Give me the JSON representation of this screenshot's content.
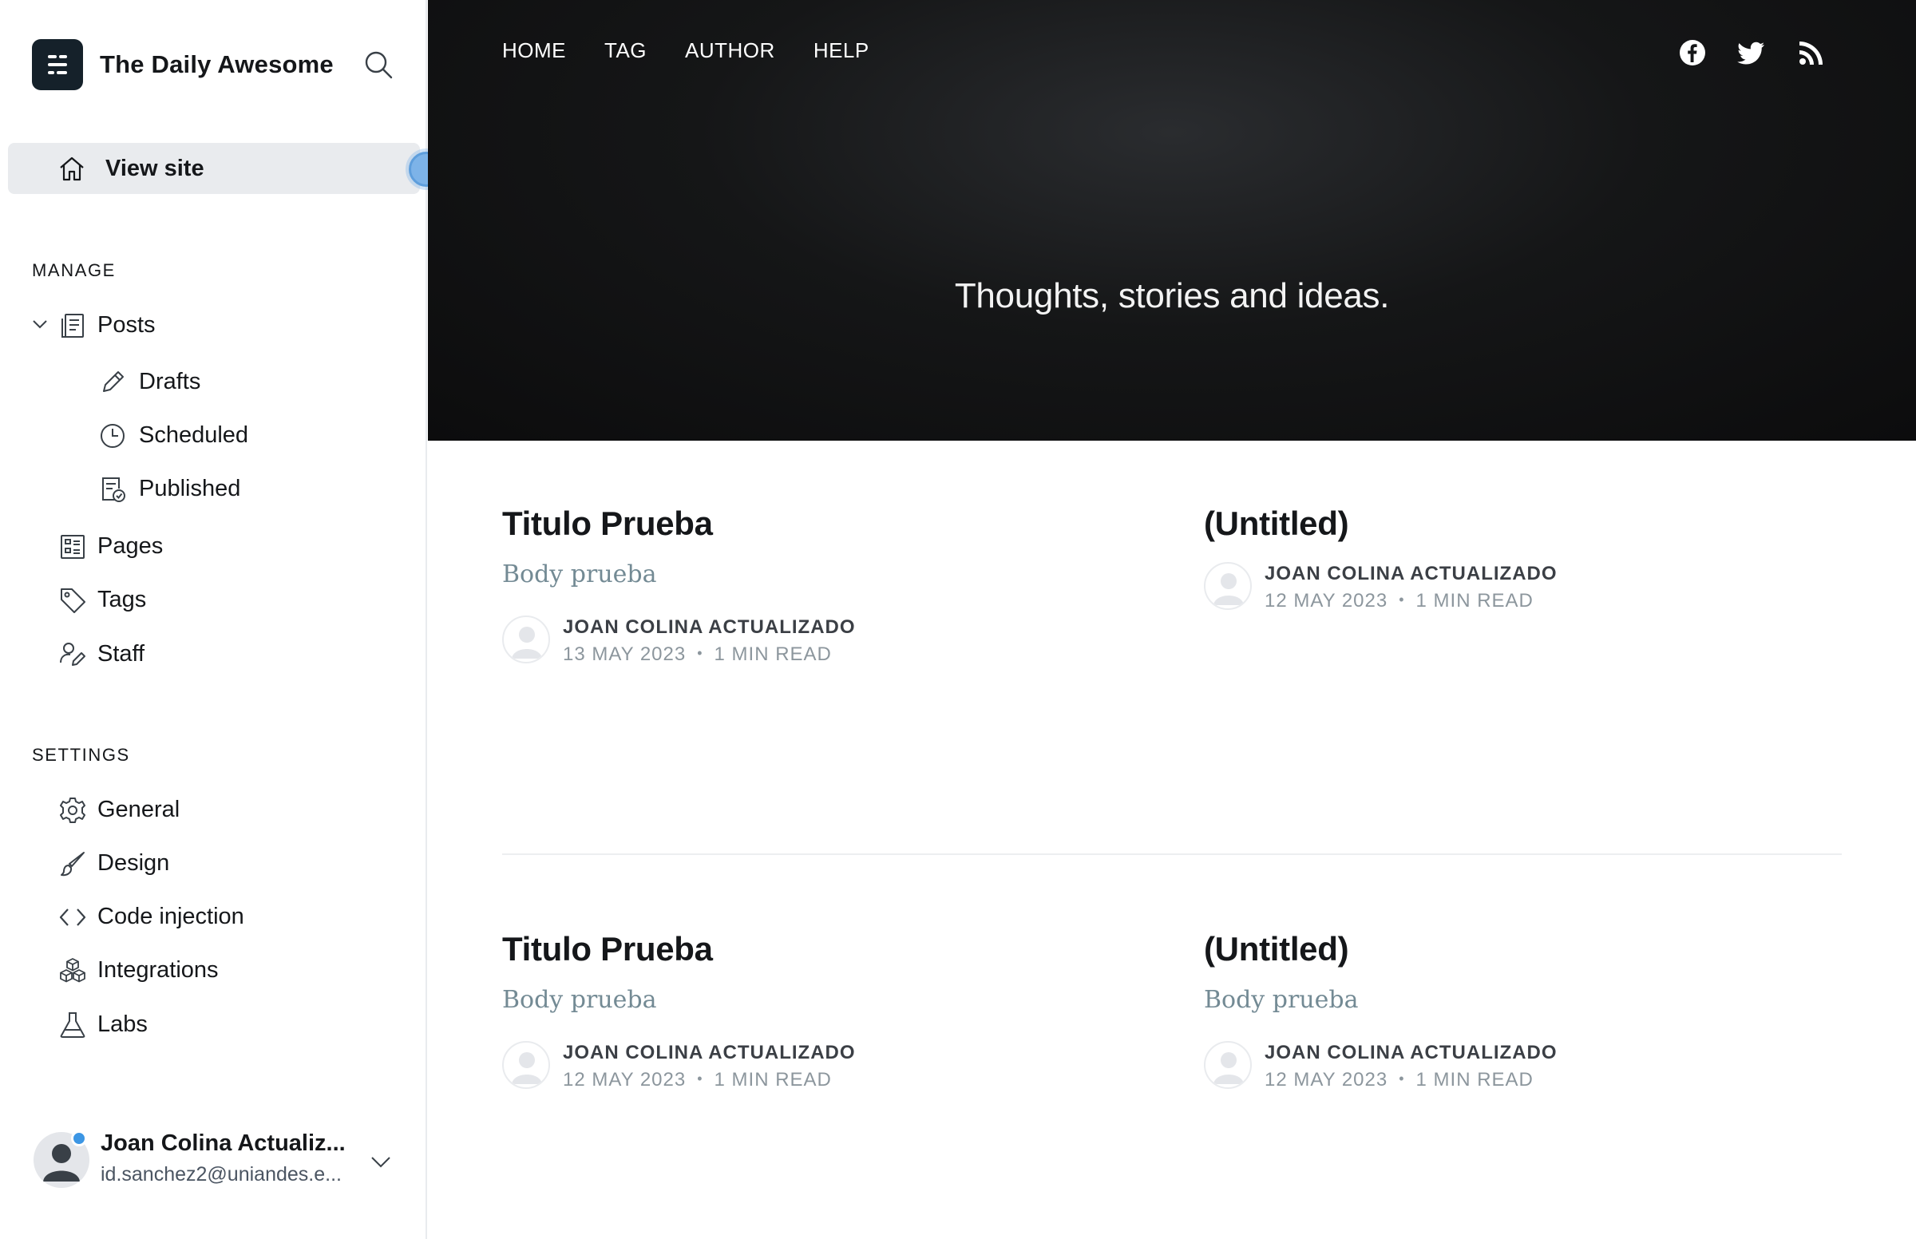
{
  "sidebar": {
    "brand_title": "The Daily Awesome",
    "view_site_label": "View site",
    "manage_title": "MANAGE",
    "manage_items": [
      {
        "label": "Posts",
        "icon": "posts-icon"
      },
      {
        "label": "Drafts",
        "icon": "pencil-icon"
      },
      {
        "label": "Scheduled",
        "icon": "clock-icon"
      },
      {
        "label": "Published",
        "icon": "published-icon"
      },
      {
        "label": "Pages",
        "icon": "pages-icon"
      },
      {
        "label": "Tags",
        "icon": "tag-icon"
      },
      {
        "label": "Staff",
        "icon": "staff-icon"
      }
    ],
    "settings_title": "SETTINGS",
    "settings_items": [
      {
        "label": "General",
        "icon": "gear-icon"
      },
      {
        "label": "Design",
        "icon": "brush-icon"
      },
      {
        "label": "Code injection",
        "icon": "code-icon"
      },
      {
        "label": "Integrations",
        "icon": "integrations-icon"
      },
      {
        "label": "Labs",
        "icon": "flask-icon"
      }
    ],
    "user": {
      "name": "Joan Colina Actualiz...",
      "email": "id.sanchez2@uniandes.e..."
    }
  },
  "site": {
    "nav": [
      "HOME",
      "TAG",
      "AUTHOR",
      "HELP"
    ],
    "social": [
      "facebook-icon",
      "twitter-icon",
      "rss-icon"
    ],
    "tagline": "Thoughts, stories and ideas.",
    "posts": [
      {
        "title": "Titulo Prueba",
        "excerpt": "Body prueba",
        "author": "JOAN COLINA ACTUALIZADO",
        "date": "13 MAY 2023",
        "read": "1 MIN READ"
      },
      {
        "title": "(Untitled)",
        "excerpt": "",
        "author": "JOAN COLINA ACTUALIZADO",
        "date": "12 MAY 2023",
        "read": "1 MIN READ"
      },
      {
        "title": "Titulo Prueba",
        "excerpt": "Body prueba",
        "author": "JOAN COLINA ACTUALIZADO",
        "date": "12 MAY 2023",
        "read": "1 MIN READ"
      },
      {
        "title": "(Untitled)",
        "excerpt": "Body prueba",
        "author": "JOAN COLINA ACTUALIZADO",
        "date": "12 MAY 2023",
        "read": "1 MIN READ"
      }
    ]
  },
  "colors": {
    "sidebar_active_bg": "#e9ebee",
    "hero_bg": "#151617",
    "brand_logo_bg": "#15212a",
    "excerpt_color": "#738a94",
    "meta_color": "#8c969d",
    "presence_dot": "#3c96e4"
  }
}
